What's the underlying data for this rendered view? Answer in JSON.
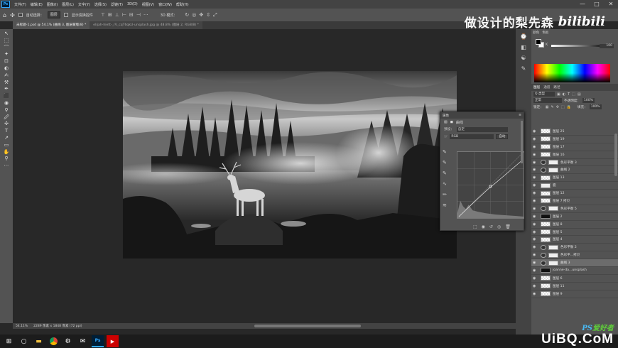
{
  "app": {
    "logo": "Ps"
  },
  "menu": [
    "文件(F)",
    "编辑(E)",
    "图像(I)",
    "图层(L)",
    "文字(Y)",
    "选择(S)",
    "滤镜(T)",
    "3D(D)",
    "视图(V)",
    "窗口(W)",
    "帮助(H)"
  ],
  "window_controls": {
    "minimize": "—",
    "maximize": "□",
    "close": "✕"
  },
  "options": {
    "auto_select_label": "自动选择：",
    "auto_select_value": "图层",
    "transform_label": "显示变换控件",
    "mode_3d": "3D 模式："
  },
  "watermark": {
    "channel": "做设计的梨先森",
    "site": "bilibili"
  },
  "tabs": [
    {
      "label": "未标题-1.psd @ 54.1% (曲线 3, 图层蒙版/8) *",
      "active": true
    },
    {
      "label": "elijah-hiett-_rV_cqT6qkU-unsplash.jpg @ 48.8% (图层 2, RGB/8) *",
      "active": false
    }
  ],
  "tools": [
    "↖",
    "⬚",
    "⌒",
    "✦",
    "⊡",
    "◐",
    "✍",
    "⚒",
    "✒",
    "⬛",
    "◉",
    "⚲",
    "🖉",
    "✣",
    "T",
    "↗",
    "▭",
    "✋",
    "⚲",
    "⋯"
  ],
  "status": {
    "zoom": "54.11%",
    "doc_size": "2289 像素 x 1848 像素 (72 ppi)"
  },
  "color_panel": {
    "tabs": [
      "颜色",
      "色板"
    ],
    "k_label": "K",
    "k_value": "100",
    "k_unit": "%"
  },
  "layers_panel": {
    "tabs": [
      "图层",
      "通道",
      "路径"
    ],
    "kind_filter": "Q 类型",
    "blend_mode": "正常",
    "opacity_label": "不透明度：",
    "opacity_value": "100%",
    "lock_label": "锁定：",
    "fill_label": "填充：",
    "fill_value": "100%",
    "layers": [
      {
        "name": "图层 25",
        "thumb": "checker"
      },
      {
        "name": "图层 19",
        "thumb": "checker"
      },
      {
        "name": "图层 17",
        "thumb": "checker"
      },
      {
        "name": "图层 16",
        "thumb": "checker"
      },
      {
        "name": "色彩平衡 3",
        "thumb": "adj"
      },
      {
        "name": "曲线 2",
        "thumb": "adj"
      },
      {
        "name": "图层 13",
        "thumb": "checker"
      },
      {
        "name": "鹿",
        "thumb": "plain"
      },
      {
        "name": "图层 12",
        "thumb": "checker"
      },
      {
        "name": "图层 7 拷贝",
        "thumb": "checker"
      },
      {
        "name": "色彩平衡 5",
        "thumb": "adj"
      },
      {
        "name": "图层 2",
        "thumb": "dark"
      },
      {
        "name": "图层 8",
        "thumb": "checker"
      },
      {
        "name": "图层 5",
        "thumb": "checker"
      },
      {
        "name": "图层 4",
        "thumb": "checker"
      },
      {
        "name": "色彩平衡 2",
        "thumb": "adj"
      },
      {
        "name": "色彩平...拷贝",
        "thumb": "adj"
      },
      {
        "name": "曲线 3",
        "thumb": "adj",
        "selected": true
      },
      {
        "name": "joanne-da...unsplash",
        "thumb": "dark"
      },
      {
        "name": "图层 6",
        "thumb": "checker"
      },
      {
        "name": "图层 11",
        "thumb": "checker"
      },
      {
        "name": "图层 9",
        "thumb": "checker"
      }
    ]
  },
  "properties": {
    "header": "属性",
    "title": "曲线",
    "preset_label": "预设：",
    "preset_value": "自定",
    "channel_value": "RGB",
    "auto_label": "自动"
  },
  "site_watermark": {
    "line1_a": "PS",
    "line1_b": "爱好者",
    "line2": "UiBQ.CoM"
  }
}
